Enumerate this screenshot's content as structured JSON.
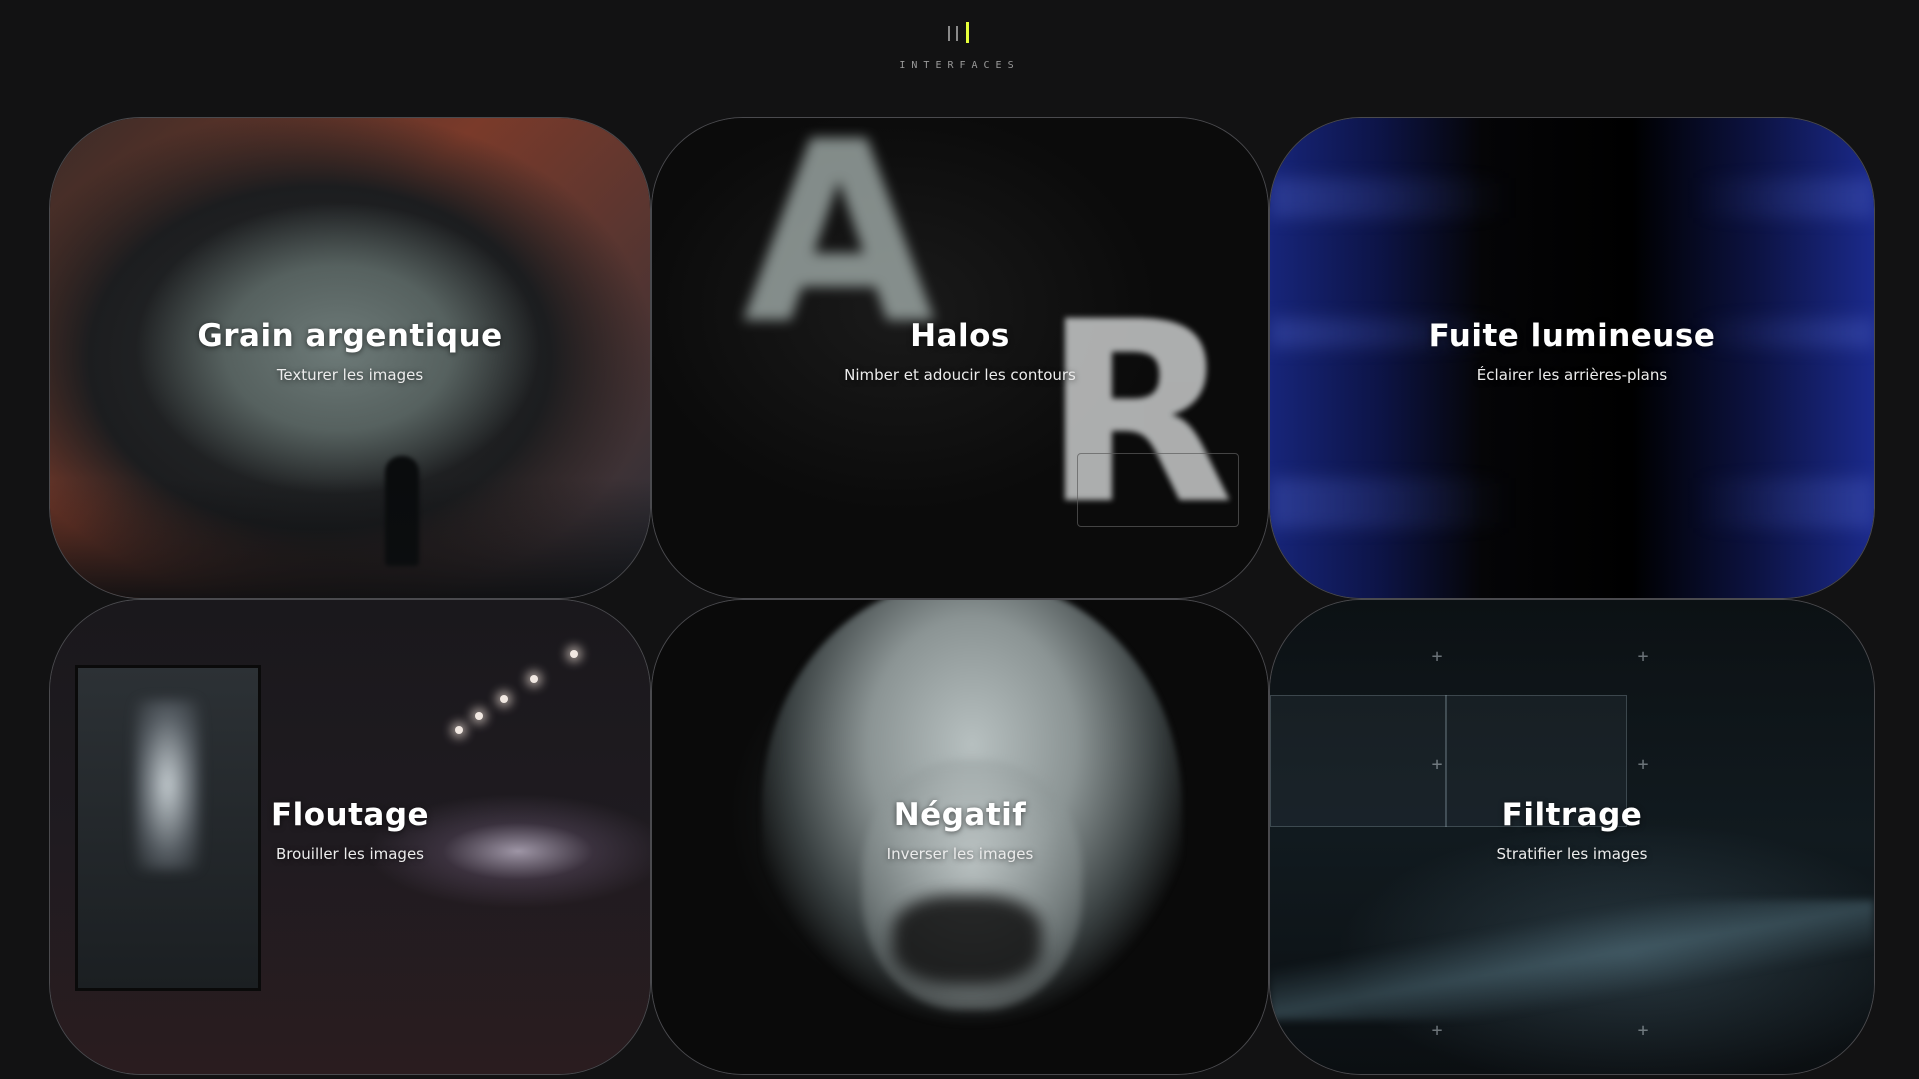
{
  "brand": {
    "name": "INTERFACES",
    "accent_color": "#e6ff3a",
    "icon": "bars-logo-icon"
  },
  "cards": [
    {
      "title": "Grain argentique",
      "subtitle": "Texturer les images"
    },
    {
      "title": "Halos",
      "subtitle": "Nimber et adoucir les contours"
    },
    {
      "title": "Fuite lumineuse",
      "subtitle": "Éclairer les arrières-plans"
    },
    {
      "title": "Floutage",
      "subtitle": "Brouiller les images"
    },
    {
      "title": "Négatif",
      "subtitle": "Inverser les images"
    },
    {
      "title": "Filtrage",
      "subtitle": "Stratifier les images"
    }
  ],
  "colors": {
    "background": "#121213",
    "card_border": "#4a4a4e",
    "text": "#ffffff"
  }
}
